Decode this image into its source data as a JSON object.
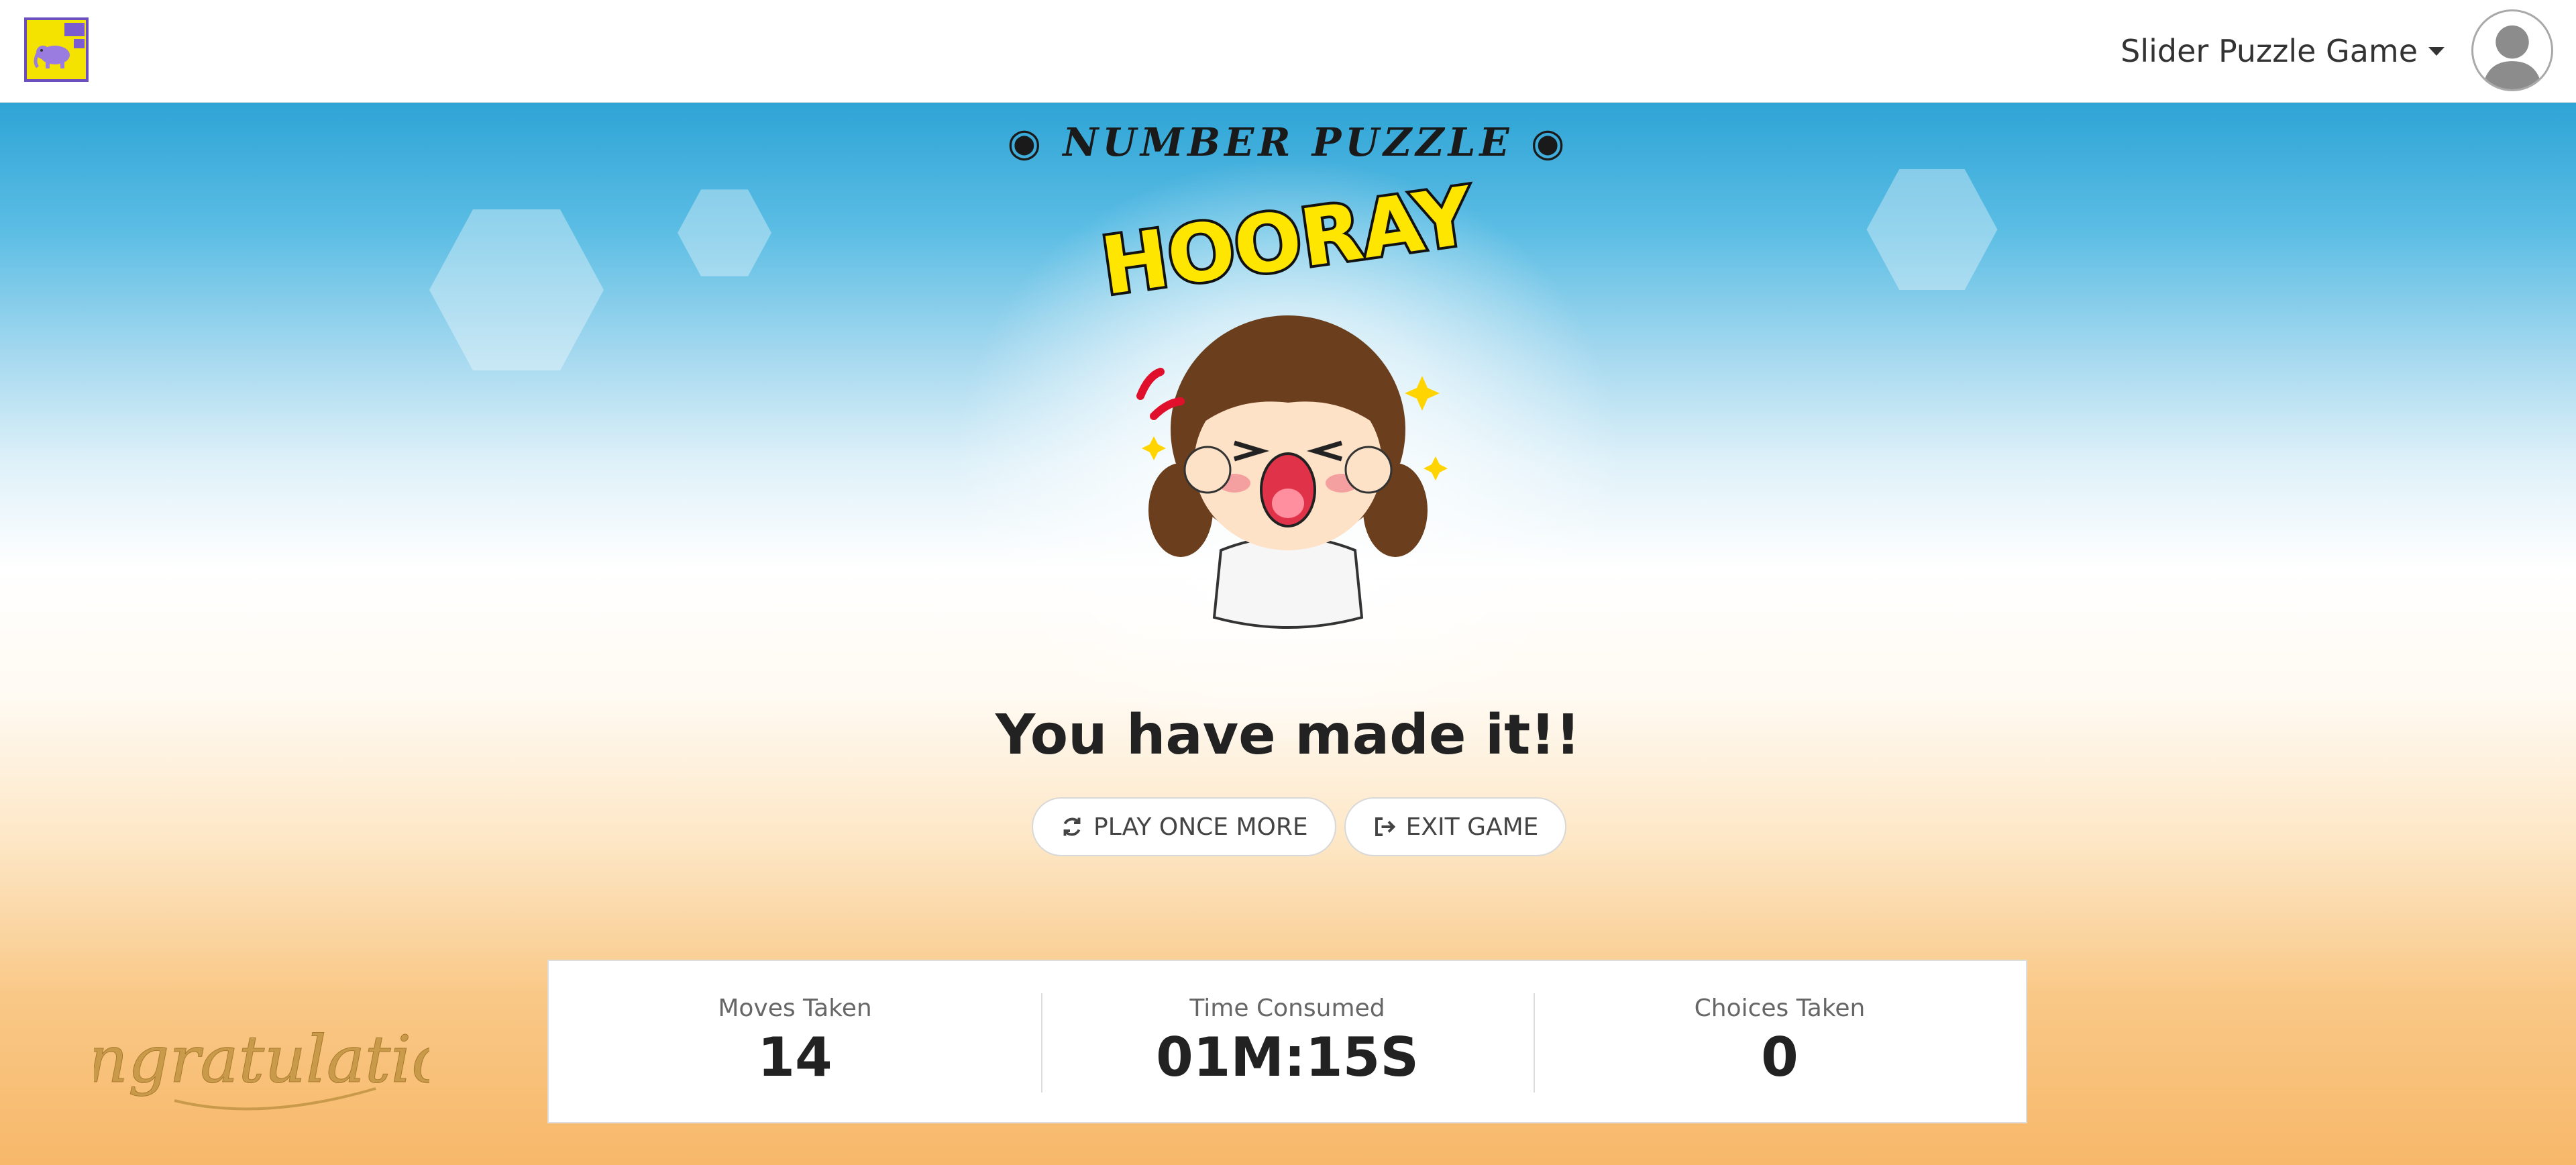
{
  "header": {
    "app_menu_label": "Slider Puzzle Game"
  },
  "hero": {
    "title": "◉ NUMBER PUZZLE ◉",
    "sticker_text": "HOORAY",
    "headline": "You have made it!!",
    "congrats_text": "Congratulations"
  },
  "actions": {
    "play_again_label": "PLAY ONCE MORE",
    "exit_label": "EXIT GAME"
  },
  "stats": [
    {
      "label": "Moves Taken",
      "value": "14"
    },
    {
      "label": "Time Consumed",
      "value": "01M:15S"
    },
    {
      "label": "Choices Taken",
      "value": "0"
    }
  ],
  "colors": {
    "sky_blue": "#2ea4d6",
    "sunset_orange": "#f7b86a",
    "logo_yellow": "#f4e200",
    "logo_purple": "#6b4fbf",
    "text_dark": "#222222"
  },
  "icons": {
    "play_again": "refresh-icon",
    "exit": "sign-out-icon"
  }
}
